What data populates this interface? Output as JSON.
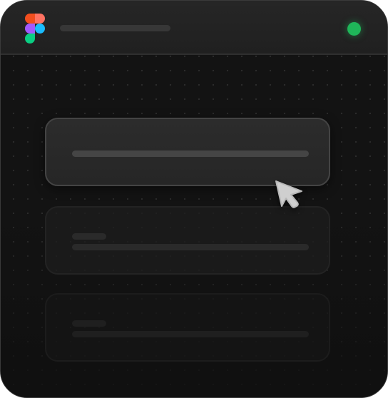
{
  "app": {
    "logo_icon": "figma-logo-icon",
    "title": "",
    "status": "online",
    "status_color": "#1fb659"
  },
  "canvas": {
    "background": "dot-grid",
    "cards": [
      {
        "state": "active",
        "label": ""
      },
      {
        "state": "faded",
        "label": ""
      },
      {
        "state": "faded",
        "label": ""
      }
    ]
  },
  "pointer_icon": "cursor-arrow-icon",
  "colors": {
    "window_bg": "#111111",
    "titlebar_bg": "#232323",
    "accent_green": "#1fb659",
    "figma_red": "#f24e1e",
    "figma_orange": "#ff7262",
    "figma_purple": "#a259ff",
    "figma_blue": "#1abcfe",
    "figma_green": "#0acf83"
  }
}
